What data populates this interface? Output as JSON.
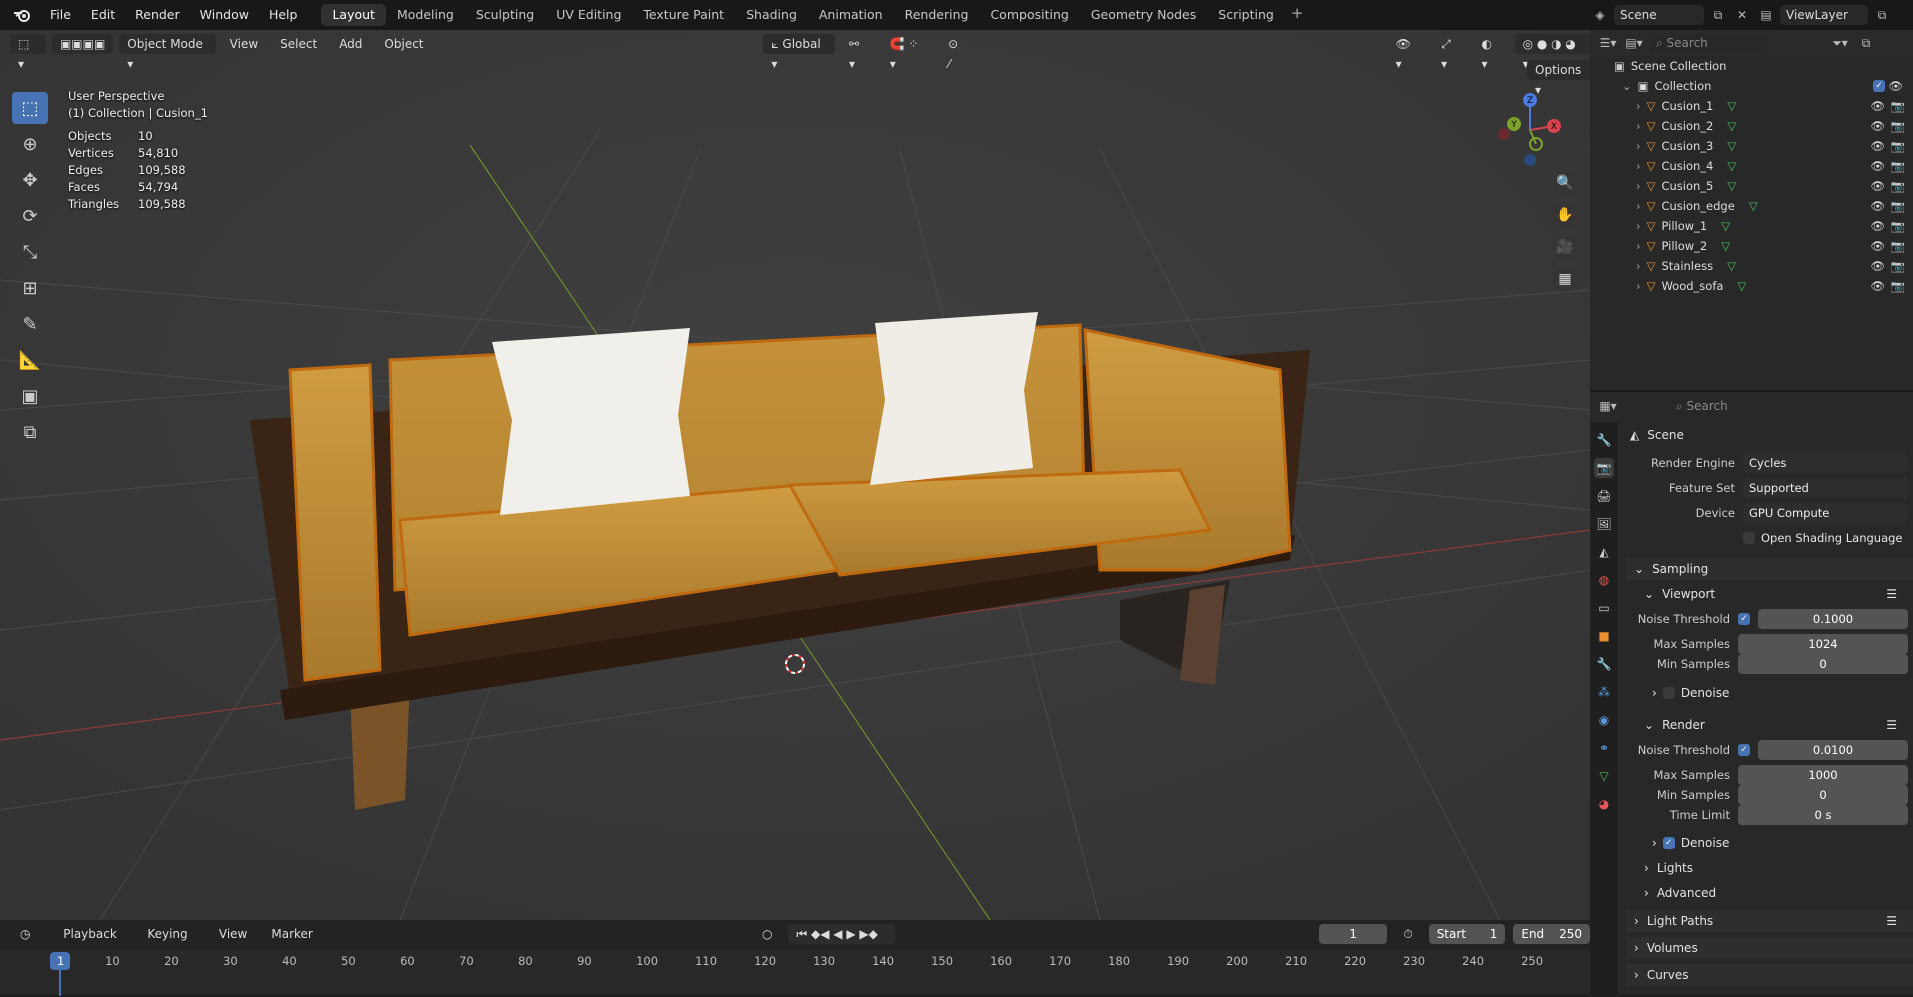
{
  "topbar": {
    "menus": [
      "File",
      "Edit",
      "Render",
      "Window",
      "Help"
    ],
    "workspaces": [
      "Layout",
      "Modeling",
      "Sculpting",
      "UV Editing",
      "Texture Paint",
      "Shading",
      "Animation",
      "Rendering",
      "Compositing",
      "Geometry Nodes",
      "Scripting"
    ],
    "active_workspace": "Layout",
    "scene": "Scene",
    "view_layer": "ViewLayer"
  },
  "viewport": {
    "mode": "Object Mode",
    "menus": [
      "View",
      "Select",
      "Add",
      "Object"
    ],
    "transform": "Global",
    "options": "Options",
    "perspective": "User Perspective",
    "context": "(1) Collection | Cusion_1",
    "stats": [
      {
        "label": "Objects",
        "value": "10"
      },
      {
        "label": "Vertices",
        "value": "54,810"
      },
      {
        "label": "Edges",
        "value": "109,588"
      },
      {
        "label": "Faces",
        "value": "54,794"
      },
      {
        "label": "Triangles",
        "value": "109,588"
      }
    ],
    "gizmo": {
      "x": "X",
      "y": "Y",
      "z": "Z"
    }
  },
  "outliner": {
    "search": "Search",
    "scene_collection": "Scene Collection",
    "collection": "Collection",
    "objects": [
      "Cusion_1",
      "Cusion_2",
      "Cusion_3",
      "Cusion_4",
      "Cusion_5",
      "Cusion_edge",
      "Pillow_1",
      "Pillow_2",
      "Stainless",
      "Wood_sofa"
    ]
  },
  "properties": {
    "search": "Search",
    "scene": "Scene",
    "render_engine_label": "Render Engine",
    "render_engine": "Cycles",
    "feature_set_label": "Feature Set",
    "feature_set": "Supported",
    "device_label": "Device",
    "device": "GPU Compute",
    "osl": "Open Shading Language",
    "sampling": "Sampling",
    "viewport": "Viewport",
    "render": "Render",
    "noise_threshold_label": "Noise Threshold",
    "vp_noise": "0.1000",
    "max_samples_label": "Max Samples",
    "vp_max": "1024",
    "min_samples_label": "Min Samples",
    "vp_min": "0",
    "denoise": "Denoise",
    "r_noise": "0.0100",
    "r_max": "1000",
    "r_min": "0",
    "time_limit_label": "Time Limit",
    "r_time": "0 s",
    "lights": "Lights",
    "advanced": "Advanced",
    "light_paths": "Light Paths",
    "volumes": "Volumes",
    "curves": "Curves"
  },
  "timeline": {
    "menus": [
      "Playback",
      "Keying",
      "View",
      "Marker"
    ],
    "current": "1",
    "start_label": "Start",
    "start": "1",
    "end_label": "End",
    "end": "250",
    "ticks": [
      "1",
      "10",
      "20",
      "30",
      "40",
      "50",
      "60",
      "70",
      "80",
      "90",
      "100",
      "110",
      "120",
      "130",
      "140",
      "150",
      "160",
      "170",
      "180",
      "190",
      "200",
      "210",
      "220",
      "230",
      "240",
      "250"
    ]
  }
}
